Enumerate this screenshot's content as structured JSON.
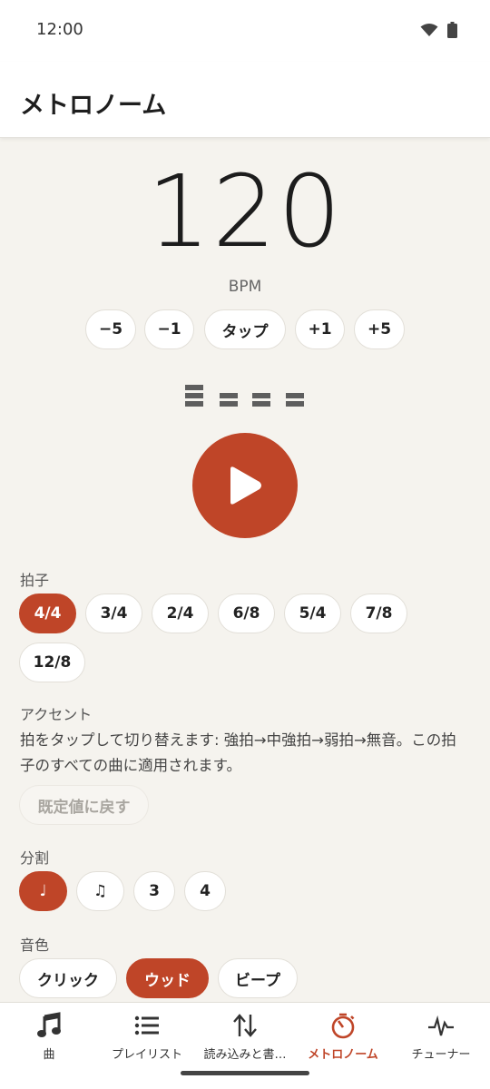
{
  "status": {
    "time": "12:00"
  },
  "app_bar": {
    "title": "メトロノーム"
  },
  "tempo": {
    "bpm": "120",
    "unit": "BPM"
  },
  "tempo_buttons": [
    "−5",
    "−1",
    "タップ",
    "+1",
    "+5"
  ],
  "beats": {
    "count": 4,
    "levels": [
      "強拍",
      "中強拍",
      "中強拍",
      "中強拍"
    ]
  },
  "play_button": {
    "icon": "play-icon",
    "state": "stopped"
  },
  "time_signature": {
    "label": "拍子",
    "options": [
      "4/4",
      "3/4",
      "2/4",
      "6/8",
      "5/4",
      "7/8",
      "12/8"
    ],
    "selected": "4/4"
  },
  "accent": {
    "label": "アクセント",
    "description": "拍をタップして切り替えます: 強拍→中強拍→弱拍→無音。この拍子のすべての曲に適用されます。",
    "reset_label": "既定値に戻す"
  },
  "subdivision": {
    "label": "分割",
    "options": [
      "♩",
      "♫",
      "3",
      "4"
    ],
    "selected": "♩"
  },
  "sound": {
    "label": "音色",
    "options": [
      "クリック",
      "ウッド",
      "ビープ"
    ],
    "selected": "ウッド"
  },
  "nav": {
    "items": [
      {
        "label": "曲",
        "icon": "music-note-icon"
      },
      {
        "label": "プレイリスト",
        "icon": "list-icon"
      },
      {
        "label": "読み込みと書…",
        "icon": "import-export-icon"
      },
      {
        "label": "メトロノーム",
        "icon": "metronome-icon",
        "active": true
      },
      {
        "label": "チューナー",
        "icon": "tuner-icon"
      }
    ]
  },
  "colors": {
    "accent": "#bf4528",
    "background": "#f5f3ee",
    "surface": "#ffffff"
  }
}
